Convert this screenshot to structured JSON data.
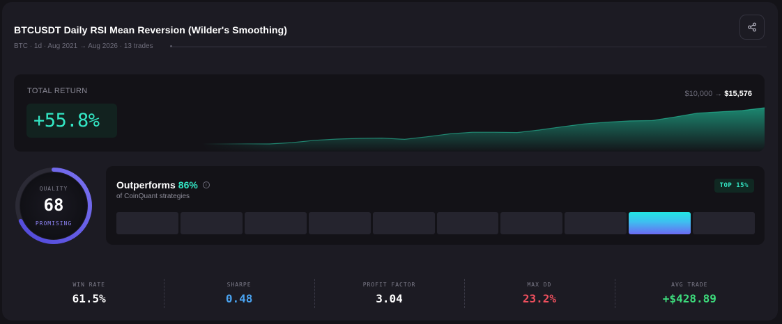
{
  "header": {
    "title": "BTCUSDT Daily RSI Mean Reversion (Wilder's Smoothing)",
    "subtitle": "BTC · 1d · Aug 2021 → Aug 2026 · 13 trades",
    "share_icon": "share-icon"
  },
  "total_return": {
    "label": "TOTAL RETURN",
    "value": "+55.8%",
    "start_capital": "$10,000",
    "arrow": "→",
    "end_capital": "$15,576",
    "accent": "#33e6c4"
  },
  "equity_curve": [
    10000,
    10000,
    10005,
    9995,
    10200,
    10550,
    10750,
    10850,
    10900,
    10700,
    11100,
    11550,
    11800,
    11800,
    11750,
    12150,
    12650,
    13100,
    13350,
    13550,
    13600,
    14150,
    14750,
    14950,
    15150,
    15576
  ],
  "quality": {
    "label": "QUALITY",
    "score": "68",
    "score_fraction": 0.68,
    "tier": "PROMISING",
    "ring_colors": [
      "#4f47d9",
      "#7a72f0"
    ]
  },
  "percentile": {
    "title": "Outperforms",
    "value": "86%",
    "info_icon": "info-icon",
    "subtitle": "of CoinQuant strategies",
    "badge": "TOP 15%",
    "buckets": 10,
    "active_bucket": 8
  },
  "metrics": [
    {
      "label": "WIN RATE",
      "value": "61.5%",
      "color": "#ffffff"
    },
    {
      "label": "SHARPE",
      "value": "0.48",
      "color": "#4aa3f0"
    },
    {
      "label": "PROFIT FACTOR",
      "value": "3.04",
      "color": "#ffffff"
    },
    {
      "label": "MAX DD",
      "value": "23.2%",
      "color": "#f0505e"
    },
    {
      "label": "AVG TRADE",
      "value": "+$428.89",
      "color": "#3ddc7c"
    }
  ]
}
